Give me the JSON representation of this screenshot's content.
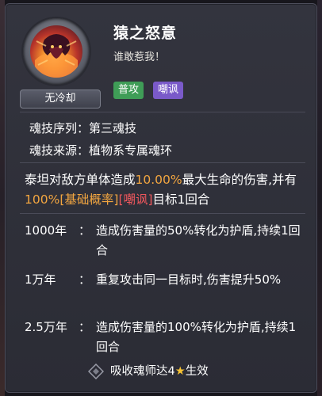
{
  "skill": {
    "name": "猿之怒意",
    "subtitle": "谁敢惹我！",
    "cooldown_badge": "无冷却",
    "tags": [
      "普攻",
      "嘲讽"
    ]
  },
  "info": {
    "order_label": "魂技序列：",
    "order_value": "第三魂技",
    "source_label": "魂技来源：",
    "source_value": "植物系专属魂环"
  },
  "description": {
    "p1": "泰坦对敌方单体造成",
    "pct1": "10.00%",
    "p2": "最大生命的伤害,并有",
    "pct2": "100%",
    "rate": "[基础概率]",
    "taunt": "[嘲讽]",
    "p3": "目标1回合"
  },
  "levels": [
    {
      "label": "1000年",
      "colon": "：",
      "text": "造成伤害量的50%转化为护盾,持续1回合"
    },
    {
      "label": "1万年",
      "colon": "：",
      "text": "重复攻击同一目标时,伤害提升50%"
    },
    {
      "label": "2.5万年",
      "colon": "：",
      "text": "造成伤害量的100%转化为护盾,持续1回合"
    }
  ],
  "footer": {
    "pre": "吸收魂师达4",
    "star": "★",
    "post": "生效"
  },
  "colors": {
    "highlight_orange": "#f3a640",
    "highlight_red": "#f0575d",
    "tag_green": "#3f9d57",
    "tag_purple": "#7a5ac9"
  }
}
